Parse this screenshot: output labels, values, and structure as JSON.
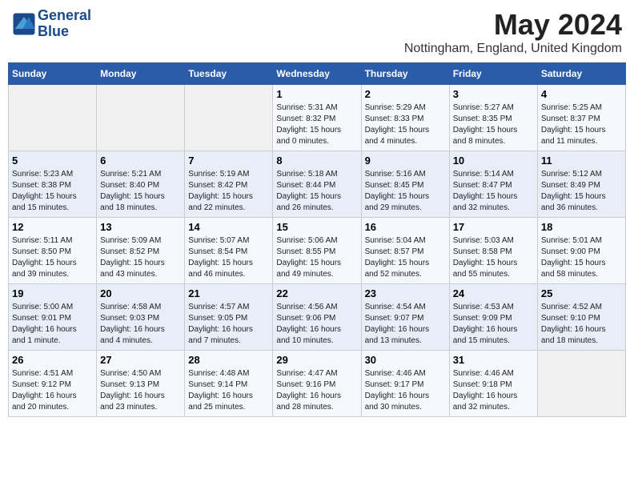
{
  "header": {
    "logo_line1": "General",
    "logo_line2": "Blue",
    "month": "May 2024",
    "location": "Nottingham, England, United Kingdom"
  },
  "weekdays": [
    "Sunday",
    "Monday",
    "Tuesday",
    "Wednesday",
    "Thursday",
    "Friday",
    "Saturday"
  ],
  "weeks": [
    [
      {
        "day": "",
        "info": ""
      },
      {
        "day": "",
        "info": ""
      },
      {
        "day": "",
        "info": ""
      },
      {
        "day": "1",
        "info": "Sunrise: 5:31 AM\nSunset: 8:32 PM\nDaylight: 15 hours\nand 0 minutes."
      },
      {
        "day": "2",
        "info": "Sunrise: 5:29 AM\nSunset: 8:33 PM\nDaylight: 15 hours\nand 4 minutes."
      },
      {
        "day": "3",
        "info": "Sunrise: 5:27 AM\nSunset: 8:35 PM\nDaylight: 15 hours\nand 8 minutes."
      },
      {
        "day": "4",
        "info": "Sunrise: 5:25 AM\nSunset: 8:37 PM\nDaylight: 15 hours\nand 11 minutes."
      }
    ],
    [
      {
        "day": "5",
        "info": "Sunrise: 5:23 AM\nSunset: 8:38 PM\nDaylight: 15 hours\nand 15 minutes."
      },
      {
        "day": "6",
        "info": "Sunrise: 5:21 AM\nSunset: 8:40 PM\nDaylight: 15 hours\nand 18 minutes."
      },
      {
        "day": "7",
        "info": "Sunrise: 5:19 AM\nSunset: 8:42 PM\nDaylight: 15 hours\nand 22 minutes."
      },
      {
        "day": "8",
        "info": "Sunrise: 5:18 AM\nSunset: 8:44 PM\nDaylight: 15 hours\nand 26 minutes."
      },
      {
        "day": "9",
        "info": "Sunrise: 5:16 AM\nSunset: 8:45 PM\nDaylight: 15 hours\nand 29 minutes."
      },
      {
        "day": "10",
        "info": "Sunrise: 5:14 AM\nSunset: 8:47 PM\nDaylight: 15 hours\nand 32 minutes."
      },
      {
        "day": "11",
        "info": "Sunrise: 5:12 AM\nSunset: 8:49 PM\nDaylight: 15 hours\nand 36 minutes."
      }
    ],
    [
      {
        "day": "12",
        "info": "Sunrise: 5:11 AM\nSunset: 8:50 PM\nDaylight: 15 hours\nand 39 minutes."
      },
      {
        "day": "13",
        "info": "Sunrise: 5:09 AM\nSunset: 8:52 PM\nDaylight: 15 hours\nand 43 minutes."
      },
      {
        "day": "14",
        "info": "Sunrise: 5:07 AM\nSunset: 8:54 PM\nDaylight: 15 hours\nand 46 minutes."
      },
      {
        "day": "15",
        "info": "Sunrise: 5:06 AM\nSunset: 8:55 PM\nDaylight: 15 hours\nand 49 minutes."
      },
      {
        "day": "16",
        "info": "Sunrise: 5:04 AM\nSunset: 8:57 PM\nDaylight: 15 hours\nand 52 minutes."
      },
      {
        "day": "17",
        "info": "Sunrise: 5:03 AM\nSunset: 8:58 PM\nDaylight: 15 hours\nand 55 minutes."
      },
      {
        "day": "18",
        "info": "Sunrise: 5:01 AM\nSunset: 9:00 PM\nDaylight: 15 hours\nand 58 minutes."
      }
    ],
    [
      {
        "day": "19",
        "info": "Sunrise: 5:00 AM\nSunset: 9:01 PM\nDaylight: 16 hours\nand 1 minute."
      },
      {
        "day": "20",
        "info": "Sunrise: 4:58 AM\nSunset: 9:03 PM\nDaylight: 16 hours\nand 4 minutes."
      },
      {
        "day": "21",
        "info": "Sunrise: 4:57 AM\nSunset: 9:05 PM\nDaylight: 16 hours\nand 7 minutes."
      },
      {
        "day": "22",
        "info": "Sunrise: 4:56 AM\nSunset: 9:06 PM\nDaylight: 16 hours\nand 10 minutes."
      },
      {
        "day": "23",
        "info": "Sunrise: 4:54 AM\nSunset: 9:07 PM\nDaylight: 16 hours\nand 13 minutes."
      },
      {
        "day": "24",
        "info": "Sunrise: 4:53 AM\nSunset: 9:09 PM\nDaylight: 16 hours\nand 15 minutes."
      },
      {
        "day": "25",
        "info": "Sunrise: 4:52 AM\nSunset: 9:10 PM\nDaylight: 16 hours\nand 18 minutes."
      }
    ],
    [
      {
        "day": "26",
        "info": "Sunrise: 4:51 AM\nSunset: 9:12 PM\nDaylight: 16 hours\nand 20 minutes."
      },
      {
        "day": "27",
        "info": "Sunrise: 4:50 AM\nSunset: 9:13 PM\nDaylight: 16 hours\nand 23 minutes."
      },
      {
        "day": "28",
        "info": "Sunrise: 4:48 AM\nSunset: 9:14 PM\nDaylight: 16 hours\nand 25 minutes."
      },
      {
        "day": "29",
        "info": "Sunrise: 4:47 AM\nSunset: 9:16 PM\nDaylight: 16 hours\nand 28 minutes."
      },
      {
        "day": "30",
        "info": "Sunrise: 4:46 AM\nSunset: 9:17 PM\nDaylight: 16 hours\nand 30 minutes."
      },
      {
        "day": "31",
        "info": "Sunrise: 4:46 AM\nSunset: 9:18 PM\nDaylight: 16 hours\nand 32 minutes."
      },
      {
        "day": "",
        "info": ""
      }
    ]
  ]
}
